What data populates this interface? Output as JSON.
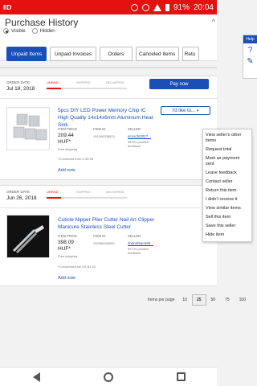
{
  "status": {
    "carrier": "IID",
    "battery": "91%",
    "time": "20:04"
  },
  "page": {
    "title": "Purchase History",
    "scroll_caret": "^"
  },
  "visibility": {
    "visible": "Visible",
    "hidden": "Hidden"
  },
  "side_tools": {
    "help": "Help"
  },
  "tabs": [
    {
      "label": "Unpaid Items"
    },
    {
      "label": "Unpaid Invoices"
    },
    {
      "label": "Orders"
    },
    {
      "label": "Canceled Items"
    },
    {
      "label": "Retu"
    }
  ],
  "steps": {
    "unpaid": "UNPAID",
    "shipped": "SHIPPED",
    "delivered": "DELIVERED"
  },
  "orders": [
    {
      "date_label": "ORDER DATE",
      "date": "Jul 18, 2018",
      "pay_label": "Pay now",
      "title": "5pcs DIY LED Power Memory Chip IC High Quality 14x14x6mm Aluminum Heat Sink",
      "price_label": "ITEM PRICE",
      "price": "209.44",
      "currency": "HUF*",
      "shipping": "Free shipping",
      "item_id_label": "ITEM ID",
      "item_id": "191346338513",
      "seller_label": "SELLER",
      "seller": "ecoschi2017...",
      "feedback": "98.5% positive feedback",
      "converted": "*Converted from C $0.99",
      "add_note": "Add note",
      "like_label": "I'd like to..."
    },
    {
      "date_label": "ORDER DATE",
      "date": "Jun 26, 2018",
      "title": "Cuticle Nipper Plier Cutter Nail Art Clipper Manicure Stainless Steel Cutter",
      "price_label": "ITEM PRICE",
      "price": "398.09",
      "currency": "HUF*",
      "shipping": "Free shipping",
      "item_id_label": "ITEM ID",
      "item_id": "263386283092",
      "seller_label": "SELLER",
      "seller": "zhanshtao186...",
      "feedback": "99.1% positive feedback",
      "converted": "*Converted from US $1.42",
      "add_note": "Add note"
    }
  ],
  "menu": [
    "View seller's other items",
    "Request total",
    "Mark as payment sent",
    "Leave feedback",
    "Contact seller",
    "Return this item",
    "I didn't receive it",
    "View similar items",
    "Sell this item",
    "Save this seller",
    "Hide item"
  ],
  "pager": {
    "label": "Items per page",
    "options": [
      "10",
      "25",
      "50",
      "75",
      "100"
    ],
    "selected": "25"
  }
}
